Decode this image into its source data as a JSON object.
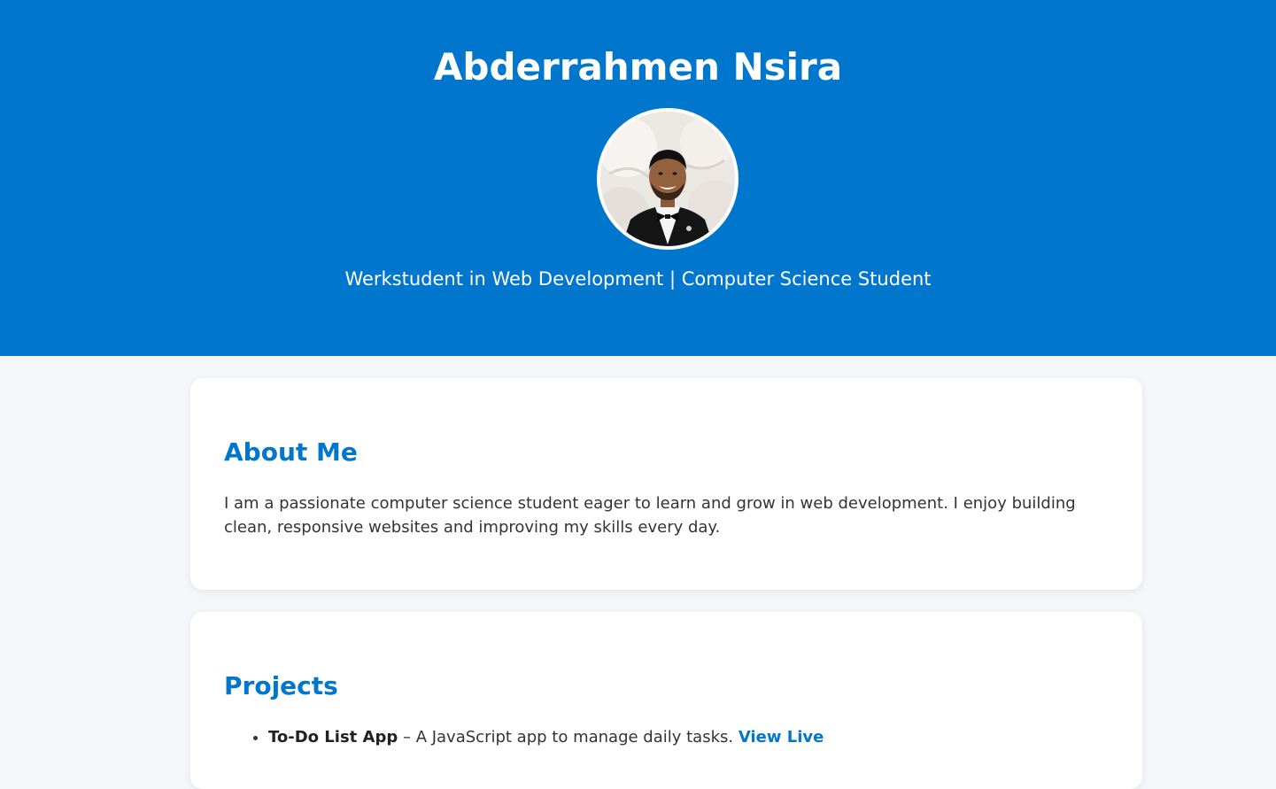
{
  "header": {
    "name": "Abderrahmen Nsira",
    "tagline": "Werkstudent in Web Development | Computer Science Student",
    "background_color": "#0077cc"
  },
  "about": {
    "title": "About Me",
    "text": "I am a passionate computer science student eager to learn and grow in web development. I enjoy building clean, responsive websites and improving my skills every day."
  },
  "projects": {
    "title": "Projects",
    "items": [
      {
        "name": "To-Do List App",
        "separator": " – ",
        "description": "A JavaScript app to manage daily tasks. ",
        "link_label": "View Live"
      }
    ]
  },
  "colors": {
    "accent": "#0077cc",
    "page_background": "#f4f6f9",
    "card_background": "#ffffff",
    "text": "#333333"
  }
}
